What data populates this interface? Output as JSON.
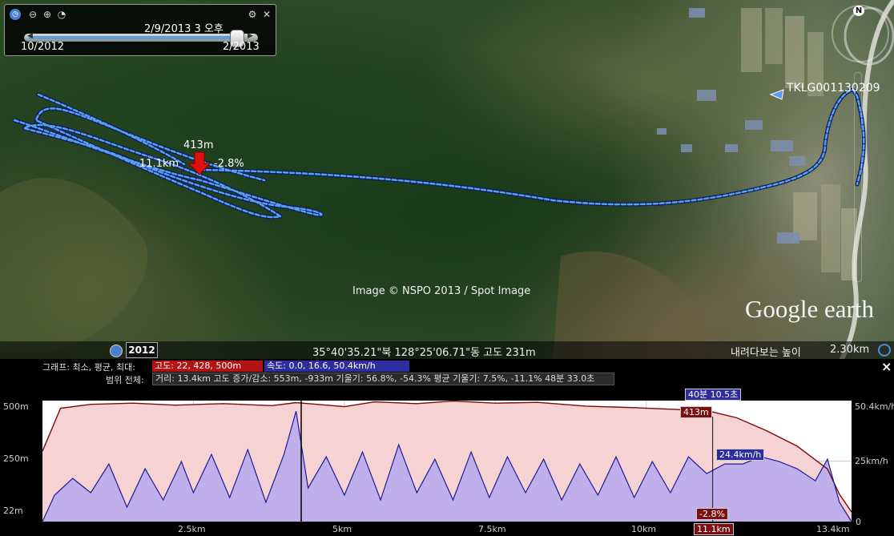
{
  "map": {
    "time_widget": {
      "current_time": "2/9/2013   3 오후",
      "range_start": "10/2012",
      "range_end": "2/2013",
      "position": 0.92
    },
    "track_name": "TKLG001130209",
    "marker": {
      "elevation": "413m",
      "distance": "11.1km",
      "slope": "-2.8%"
    },
    "copyright": "Image © NSPO 2013 / Spot Image",
    "logo": "Google earth",
    "compass_label": "N",
    "statusbar": {
      "year": "2012",
      "coords": "35°40'35.21\"북 128°25'06.71\"동 고도   231m",
      "eye_label": "내려다보는 높이",
      "eye_value": "2.30km"
    },
    "colors": {
      "track": "#4f8fe0",
      "marker": "#e01010"
    }
  },
  "graph": {
    "close_label": "×",
    "row1_label": "그래프: 최소, 평균, 최대:",
    "row2_label": "범위 전체:",
    "legend_elev": "고도: 22, 428, 500m",
    "legend_speed": "속도: 0.0, 16.6, 50.4km/h",
    "range_stats": "거리: 13.4km 고도 증가/감소: 553m, -933m 기울기: 56.8%, -54.3% 평균 기울기: 7.5%, -11.1% 48분 33.0초",
    "cursor_time": "40분 10.5초",
    "cursor_elev": "413m",
    "cursor_speed": "24.4km/h",
    "cursor_slope": "-2.8%",
    "cursor_dist": "11.1km",
    "colors": {
      "elev_line": "#7a0a0a",
      "elev_fill": "#f7d2d2",
      "speed_line": "#1a1a9a",
      "speed_fill": "#bfb0ec",
      "elev_legend": "#b21414",
      "speed_legend": "#2d2d9e"
    }
  },
  "chart_data": {
    "type": "area",
    "x_unit": "km",
    "x_range": [
      0,
      13.4
    ],
    "x_ticks": [
      "2.5km",
      "5km",
      "7.5km",
      "10km",
      "13.4km"
    ],
    "left_axis_ticks": [
      "500m",
      "250m",
      "22m"
    ],
    "right_axis_ticks": [
      "50.4km/h",
      "25km/h",
      "0"
    ],
    "left_axis_range": [
      22,
      500
    ],
    "right_axis_range": [
      0,
      50.4
    ],
    "cursor_x": 11.1,
    "series": [
      {
        "name": "고도",
        "unit": "m",
        "x": [
          0,
          0.3,
          0.8,
          1.5,
          2.2,
          3.0,
          3.8,
          4.2,
          5.0,
          5.5,
          6.2,
          6.8,
          7.5,
          8.2,
          9.0,
          9.8,
          10.5,
          11.1,
          11.5,
          12.0,
          12.5,
          13.0,
          13.2,
          13.4
        ],
        "values": [
          300,
          470,
          485,
          490,
          482,
          488,
          480,
          492,
          476,
          495,
          488,
          498,
          490,
          493,
          478,
          472,
          465,
          455,
          432,
          380,
          320,
          230,
          130,
          60
        ]
      },
      {
        "name": "속도",
        "unit": "km/h",
        "x": [
          0,
          0.2,
          0.5,
          0.8,
          1.1,
          1.4,
          1.7,
          2.0,
          2.3,
          2.5,
          2.8,
          3.1,
          3.4,
          3.7,
          4.0,
          4.2,
          4.4,
          4.7,
          5.0,
          5.3,
          5.6,
          5.9,
          6.2,
          6.5,
          6.8,
          7.1,
          7.4,
          7.7,
          8.0,
          8.3,
          8.6,
          8.9,
          9.2,
          9.5,
          9.8,
          10.1,
          10.4,
          10.7,
          11.0,
          11.3,
          11.6,
          11.9,
          12.2,
          12.5,
          12.8,
          13.0,
          13.2,
          13.4
        ],
        "values": [
          0,
          11,
          18,
          12,
          24,
          6,
          22,
          9,
          25,
          12,
          28,
          10,
          30,
          8,
          28,
          46,
          14,
          27,
          11,
          29,
          9,
          32,
          12,
          26,
          9,
          29,
          10,
          27,
          12,
          26,
          9,
          24,
          11,
          27,
          10,
          25,
          12,
          27,
          20,
          24,
          24,
          27,
          25,
          22,
          17,
          26,
          8,
          0
        ]
      }
    ]
  }
}
